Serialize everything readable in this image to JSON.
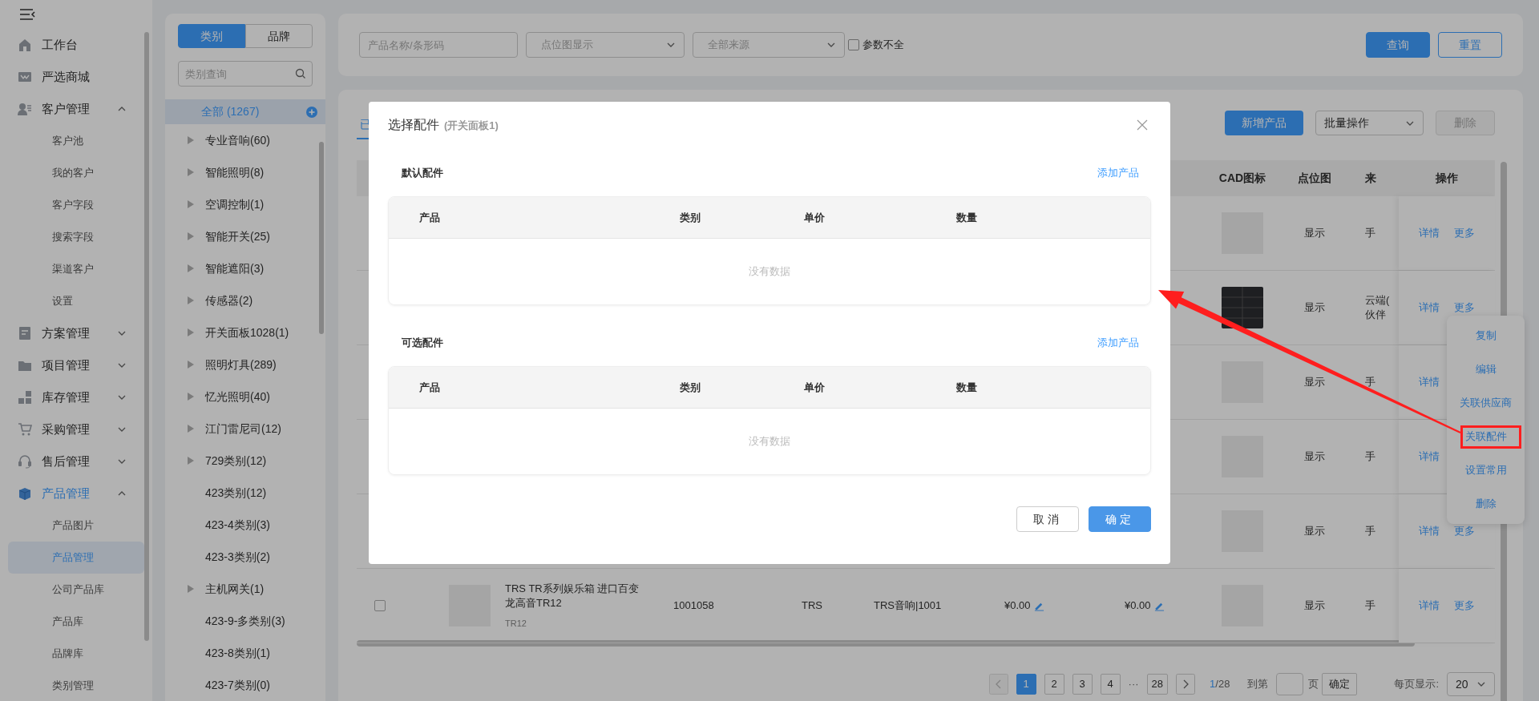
{
  "sidebar": {
    "items": [
      {
        "label": "工作台",
        "selected": false
      },
      {
        "label": "严选商城",
        "selected": false
      },
      {
        "label": "客户管理",
        "selected": false,
        "expanded": true,
        "children": [
          {
            "label": "客户池",
            "selected": false
          },
          {
            "label": "我的客户",
            "selected": false
          },
          {
            "label": "客户字段",
            "selected": false
          },
          {
            "label": "搜索字段",
            "selected": false
          },
          {
            "label": "渠道客户",
            "selected": false
          },
          {
            "label": "设置",
            "selected": false
          }
        ]
      },
      {
        "label": "方案管理",
        "selected": false,
        "expanded": false
      },
      {
        "label": "项目管理",
        "selected": false,
        "expanded": false
      },
      {
        "label": "库存管理",
        "selected": false,
        "expanded": false
      },
      {
        "label": "采购管理",
        "selected": false,
        "expanded": false
      },
      {
        "label": "售后管理",
        "selected": false,
        "expanded": false
      },
      {
        "label": "产品管理",
        "selected": true,
        "expanded": true,
        "children": [
          {
            "label": "产品图片",
            "selected": false
          },
          {
            "label": "产品管理",
            "selected": true
          },
          {
            "label": "公司产品库",
            "selected": false
          },
          {
            "label": "产品库",
            "selected": false
          },
          {
            "label": "品牌库",
            "selected": false
          },
          {
            "label": "类别管理",
            "selected": false
          }
        ]
      }
    ]
  },
  "category_panel": {
    "tabs": [
      {
        "label": "类别",
        "selected": true
      },
      {
        "label": "品牌",
        "selected": false
      }
    ],
    "search": {
      "placeholder": "类别查询"
    },
    "all": {
      "label": "全部 (1267)",
      "selected": true
    },
    "items": [
      {
        "label": "专业音响(60)",
        "expandable": true
      },
      {
        "label": "智能照明(8)",
        "expandable": true
      },
      {
        "label": "空调控制(1)",
        "expandable": true
      },
      {
        "label": "智能开关(25)",
        "expandable": true
      },
      {
        "label": "智能遮阳(3)",
        "expandable": true
      },
      {
        "label": "传感器(2)",
        "expandable": true
      },
      {
        "label": "开关面板1028(1)",
        "expandable": true
      },
      {
        "label": "照明灯具(289)",
        "expandable": true
      },
      {
        "label": "忆光照明(40)",
        "expandable": true
      },
      {
        "label": "江门雷尼司(12)",
        "expandable": true
      },
      {
        "label": "729类别(12)",
        "expandable": true
      },
      {
        "label": "423类别(12)",
        "expandable": false
      },
      {
        "label": "423-4类别(3)",
        "expandable": false
      },
      {
        "label": "423-3类别(2)",
        "expandable": false
      },
      {
        "label": "主机网关(1)",
        "expandable": true
      },
      {
        "label": "423-9-多类别(3)",
        "expandable": false
      },
      {
        "label": "423-8类别(1)",
        "expandable": false
      },
      {
        "label": "423-7类别(0)",
        "expandable": false
      }
    ]
  },
  "filters": {
    "name": {
      "placeholder": "产品名称/条形码"
    },
    "point_map": {
      "placeholder": "点位图显示"
    },
    "source": {
      "placeholder": "全部来源"
    },
    "incomplete": {
      "label": "参数不全",
      "checked": false
    },
    "buttons": [
      {
        "label": "查询",
        "kind": "primary"
      },
      {
        "label": "重置",
        "kind": "outline"
      }
    ]
  },
  "toolbar": {
    "tab": {
      "label": "已",
      "selected": true
    },
    "add_button": "新增产品",
    "batch_select": {
      "value": "批量操作"
    },
    "delete_button": {
      "label": "删除",
      "disabled": true
    }
  },
  "table": {
    "header": {
      "cad": "CAD图标",
      "point_map": "点位图",
      "source": "来",
      "actions": "操作"
    },
    "rows": [
      {
        "cad": {
          "kind": "placeholder"
        },
        "point_map": "显示",
        "source": [
          "手"
        ],
        "actions": [
          "详情",
          "更多"
        ]
      },
      {
        "cad": {
          "kind": "panel"
        },
        "point_map": "显示",
        "source": [
          "云端(",
          "伙伴"
        ],
        "actions": [
          "详情",
          "更多"
        ]
      },
      {
        "cad": {
          "kind": "placeholder"
        },
        "point_map": "显示",
        "source": [
          "手"
        ],
        "actions": [
          "详情"
        ]
      },
      {
        "cad": {
          "kind": "placeholder"
        },
        "point_map": "显示",
        "source": [
          "手"
        ],
        "actions": [
          "详情"
        ]
      },
      {
        "cad": {
          "kind": "placeholder"
        },
        "point_map": "显示",
        "source": [
          "手"
        ],
        "actions": [
          "详情",
          "更多"
        ]
      },
      {
        "checked": false,
        "thumbnail": {
          "kind": "placeholder"
        },
        "name": "TRS TR系列娱乐箱 进口百变龙高音TR12",
        "model": "TR12",
        "column_3": "1001058",
        "column_4": "TRS",
        "column_5": "TRS音响|1001",
        "price_1": "¥0.00",
        "price_2": "¥0.00",
        "cad": {
          "kind": "placeholder"
        },
        "point_map": "显示",
        "source": [
          "手"
        ],
        "actions": [
          "详情",
          "更多"
        ]
      }
    ]
  },
  "row_menu": {
    "items": [
      {
        "label": "复制",
        "highlighted": false
      },
      {
        "label": "编辑",
        "highlighted": false
      },
      {
        "label": "关联供应商",
        "highlighted": false
      },
      {
        "label": "关联配件",
        "highlighted": true
      },
      {
        "label": "设置常用",
        "highlighted": false
      },
      {
        "label": "删除",
        "highlighted": false
      }
    ]
  },
  "pagination": {
    "items": [
      {
        "label": "1",
        "kind": "page",
        "selected": true
      },
      {
        "label": "2",
        "kind": "page",
        "selected": false
      },
      {
        "label": "3",
        "kind": "page",
        "selected": false
      },
      {
        "label": "4",
        "kind": "page",
        "selected": false
      },
      {
        "label": "···",
        "kind": "ellipsis"
      },
      {
        "label": "28",
        "kind": "page",
        "selected": false
      }
    ],
    "current_page": "1",
    "total": "/28",
    "goto_label": "到第",
    "goto_suffix": "页",
    "goto_button": "确定",
    "page_size_label": "每页显示:",
    "page_size": "20"
  },
  "modal": {
    "title": "选择配件",
    "subtitle": "(开关面板1)",
    "sections": [
      {
        "title": "默认配件",
        "add_link": "添加产品",
        "columns": [
          "产品",
          "类别",
          "单价",
          "数量"
        ],
        "empty": "没有数据"
      },
      {
        "title": "可选配件",
        "add_link": "添加产品",
        "columns": [
          "产品",
          "类别",
          "单价",
          "数量"
        ],
        "empty": "没有数据"
      }
    ],
    "buttons": [
      {
        "label": "取消",
        "kind": "secondary"
      },
      {
        "label": "确定",
        "kind": "primary"
      }
    ]
  }
}
